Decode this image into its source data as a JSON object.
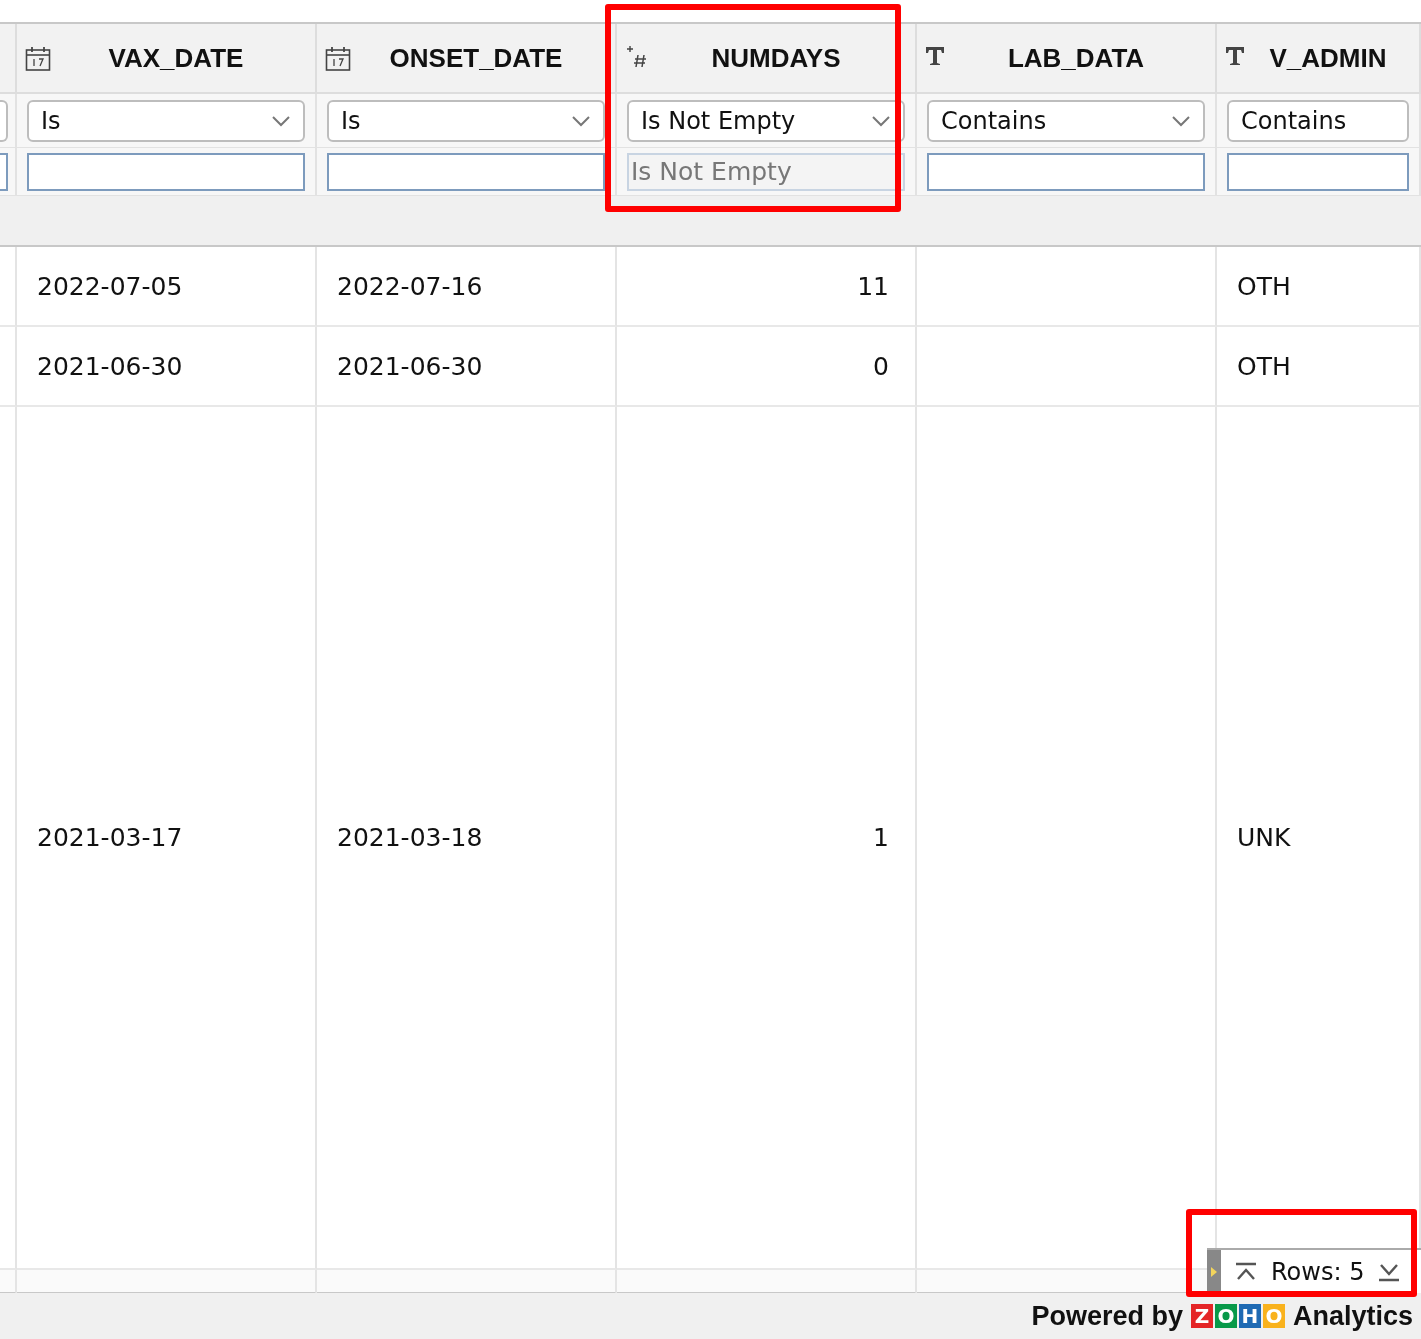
{
  "columns": [
    {
      "kind": "date",
      "title": "VAX_DATE",
      "operator": "Is",
      "filter_disabled": false,
      "highlighted": false
    },
    {
      "kind": "date",
      "title": "ONSET_DATE",
      "operator": "Is",
      "filter_disabled": false,
      "highlighted": false
    },
    {
      "kind": "number",
      "title": "NUMDAYS",
      "operator": "Is Not Empty",
      "filter_value": "Is Not Empty",
      "filter_disabled": true,
      "highlighted": true
    },
    {
      "kind": "text",
      "title": "LAB_DATA",
      "operator": "Contains",
      "filter_disabled": false,
      "highlighted": false
    },
    {
      "kind": "text",
      "title": "V_ADMIN",
      "operator": "Contains",
      "filter_disabled": false,
      "highlighted": false
    }
  ],
  "rows": [
    {
      "kind": "normal",
      "cells": [
        "2022-07-05",
        "2022-07-16",
        "11",
        "",
        "OTH"
      ]
    },
    {
      "kind": "normal",
      "cells": [
        "2021-06-30",
        "2021-06-30",
        "0",
        "",
        "OTH"
      ]
    },
    {
      "kind": "tall",
      "cells": [
        "2021-03-17",
        "2021-03-18",
        "1",
        "",
        "UNK"
      ]
    }
  ],
  "row_counter": {
    "label": "Rows: 5",
    "highlighted": true
  },
  "footer": {
    "powered_by": "Powered by",
    "logo_letters": [
      {
        "letter": "Z",
        "color": "#e42527"
      },
      {
        "letter": "O",
        "color": "#089949"
      },
      {
        "letter": "H",
        "color": "#1f6ab3"
      },
      {
        "letter": "O",
        "color": "#f9b21d"
      }
    ],
    "product": "Analytics"
  }
}
